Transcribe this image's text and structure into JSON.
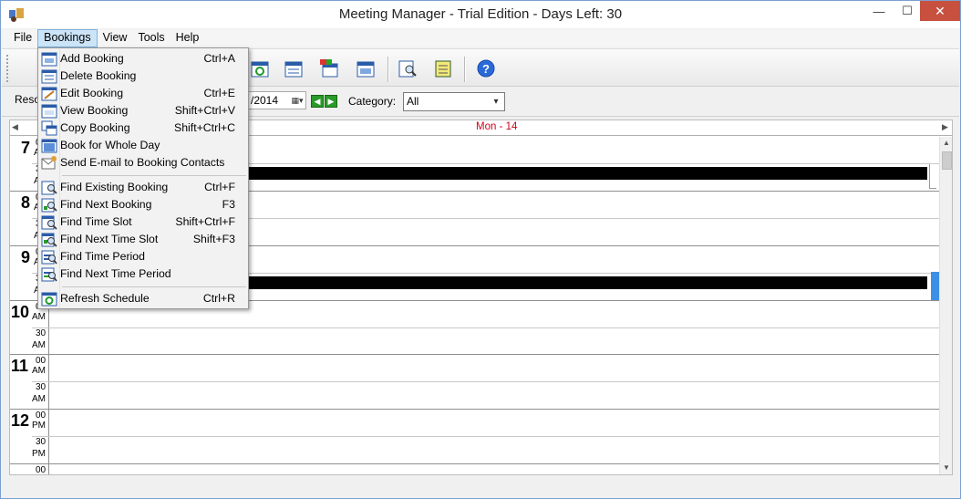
{
  "window": {
    "title": "Meeting Manager - Trial Edition - Days Left:  30",
    "minimize": "—",
    "maximize": "☐",
    "close": "✕"
  },
  "menubar": {
    "file": "File",
    "bookings": "Bookings",
    "view": "View",
    "tools": "Tools",
    "help": "Help"
  },
  "filterbar": {
    "resource_label": "Reso",
    "date_value": "/2014",
    "category_label": "Category:",
    "category_value": "All"
  },
  "schedule": {
    "day_header": "Mon - 14",
    "hours": [
      {
        "hour": "7",
        "top_min": "00",
        "top_ampm": "A",
        "bot_min": "3",
        "bot_ampm": "A"
      },
      {
        "hour": "8",
        "top_min": "0",
        "top_ampm": "A",
        "bot_min": "3",
        "bot_ampm": "A"
      },
      {
        "hour": "9",
        "top_min": "0",
        "top_ampm": "A",
        "bot_min": "3",
        "bot_ampm": "A"
      },
      {
        "hour": "10",
        "top_min": "00",
        "top_ampm": "AM",
        "bot_min": "30",
        "bot_ampm": "AM"
      },
      {
        "hour": "11",
        "top_min": "00",
        "top_ampm": "AM",
        "bot_min": "30",
        "bot_ampm": "AM"
      },
      {
        "hour": "12",
        "top_min": "00",
        "top_ampm": "PM",
        "bot_min": "30",
        "bot_ampm": "PM"
      }
    ],
    "next_hour_min": "00"
  },
  "bookings_menu": {
    "items": [
      {
        "label": "Add Booking",
        "shortcut": "Ctrl+A"
      },
      {
        "label": "Delete Booking",
        "shortcut": ""
      },
      {
        "label": "Edit Booking",
        "shortcut": "Ctrl+E"
      },
      {
        "label": "View Booking",
        "shortcut": "Shift+Ctrl+V"
      },
      {
        "label": "Copy Booking",
        "shortcut": "Shift+Ctrl+C"
      },
      {
        "label": "Book for Whole Day",
        "shortcut": ""
      },
      {
        "label": "Send E-mail to Booking Contacts",
        "shortcut": ""
      },
      {
        "label": "Find Existing Booking",
        "shortcut": "Ctrl+F"
      },
      {
        "label": "Find Next Booking",
        "shortcut": "F3"
      },
      {
        "label": "Find Time Slot",
        "shortcut": "Shift+Ctrl+F"
      },
      {
        "label": "Find Next Time Slot",
        "shortcut": "Shift+F3"
      },
      {
        "label": "Find Time Period",
        "shortcut": ""
      },
      {
        "label": "Find Next Time Period",
        "shortcut": ""
      },
      {
        "label": "Refresh Schedule",
        "shortcut": "Ctrl+R"
      }
    ]
  }
}
